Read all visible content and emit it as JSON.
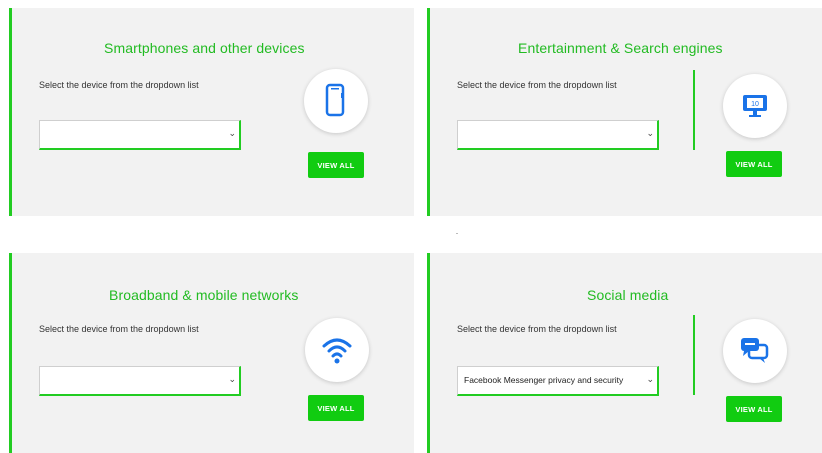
{
  "colors": {
    "accent": "#22cc22",
    "button": "#11cc11",
    "icon": "#1a73e8",
    "card_bg": "#f2f2f2"
  },
  "cards": [
    {
      "title": "Smartphones and other devices",
      "instruction": "Select the device from the dropdown list",
      "select_value": "",
      "button_label": "VIEW ALL",
      "icon": "smartphone-icon"
    },
    {
      "title": "Entertainment & Search engines",
      "instruction": "Select the device from the dropdown list",
      "select_value": "",
      "button_label": "VIEW ALL",
      "icon": "tv-icon"
    },
    {
      "title": "Broadband & mobile networks",
      "instruction": "Select the device from the dropdown list",
      "select_value": "",
      "button_label": "VIEW ALL",
      "icon": "wifi-icon"
    },
    {
      "title": "Social media",
      "instruction": "Select the device from the dropdown list",
      "select_value": "Facebook Messenger privacy and security",
      "button_label": "VIEW ALL",
      "icon": "chat-bubbles-icon"
    }
  ]
}
